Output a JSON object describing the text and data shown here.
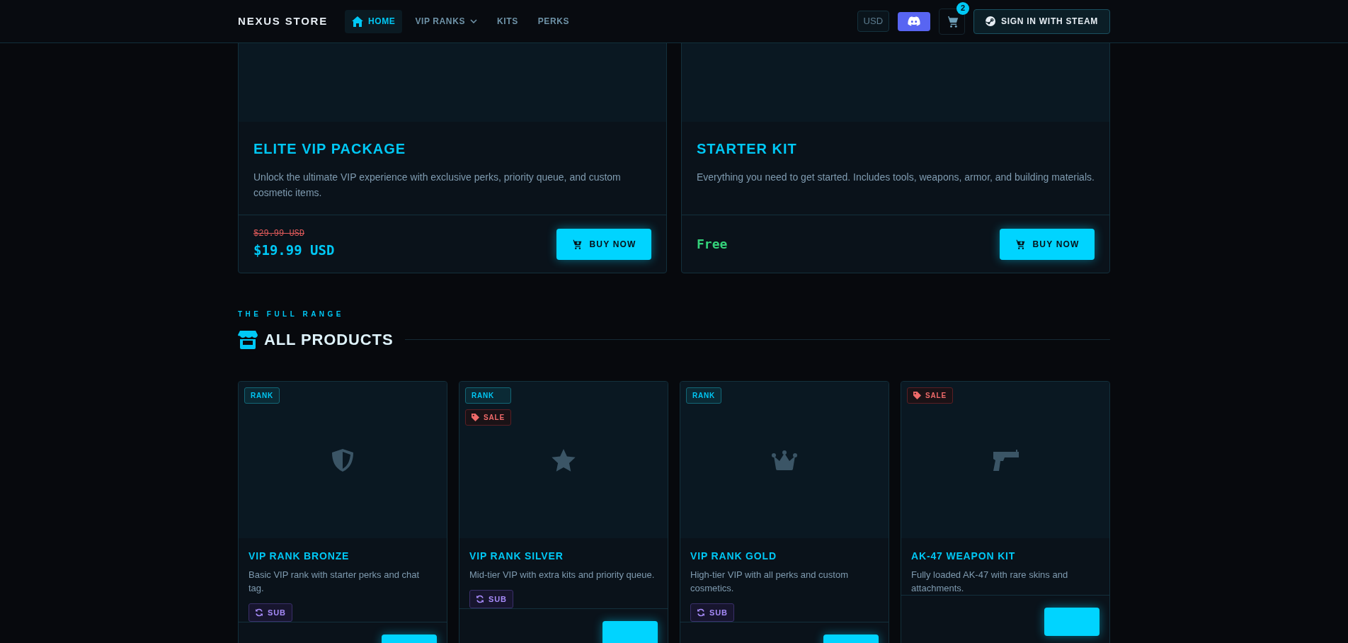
{
  "nav": {
    "brand": "NEXUS STORE",
    "links": [
      {
        "label": "HOME",
        "selected": true,
        "home": true,
        "dropdown": false
      },
      {
        "label": "VIP RANKS",
        "selected": false,
        "home": false,
        "dropdown": true
      },
      {
        "label": "KITS",
        "selected": false,
        "home": false,
        "dropdown": false
      },
      {
        "label": "PERKS",
        "selected": false,
        "home": false,
        "dropdown": false
      }
    ],
    "currency": "USD",
    "cart_count": "2",
    "sign_in": "SIGN IN WITH STEAM"
  },
  "featured": [
    {
      "title": "ELITE VIP PACKAGE",
      "description": "Unlock the ultimate VIP experience with exclusive perks, priority queue, and custom cosmetic items.",
      "old_price": "$29.99 USD",
      "price": "$19.99 USD",
      "free": false,
      "button": "BUY NOW"
    },
    {
      "title": "STARTER KIT",
      "description": "Everything you need to get started. Includes tools, weapons, armor, and building materials.",
      "price": "Free",
      "free": true,
      "button": "BUY NOW"
    }
  ],
  "section": {
    "eyebrow": "THE FULL RANGE",
    "title": "ALL PRODUCTS"
  },
  "products": [
    {
      "badges": [
        {
          "kind": "rank",
          "label": "RANK"
        }
      ],
      "title": "VIP RANK BRONZE",
      "description": "Basic VIP rank with starter perks and chat tag.",
      "tag": "SUB"
    },
    {
      "badges": [
        {
          "kind": "rank",
          "label": "RANK"
        },
        {
          "kind": "sale",
          "label": "SALE"
        }
      ],
      "title": "VIP RANK SILVER",
      "description": "Mid-tier VIP with extra kits and priority queue.",
      "tag": "SUB"
    },
    {
      "badges": [
        {
          "kind": "rank",
          "label": "RANK"
        }
      ],
      "title": "VIP RANK GOLD",
      "description": "High-tier VIP with all perks and custom cosmetics.",
      "tag": "SUB"
    },
    {
      "badges": [
        {
          "kind": "sale",
          "label": "SALE"
        }
      ],
      "title": "AK-47 WEAPON KIT",
      "description": "Fully loaded AK-47 with rare skins and attachments."
    }
  ]
}
